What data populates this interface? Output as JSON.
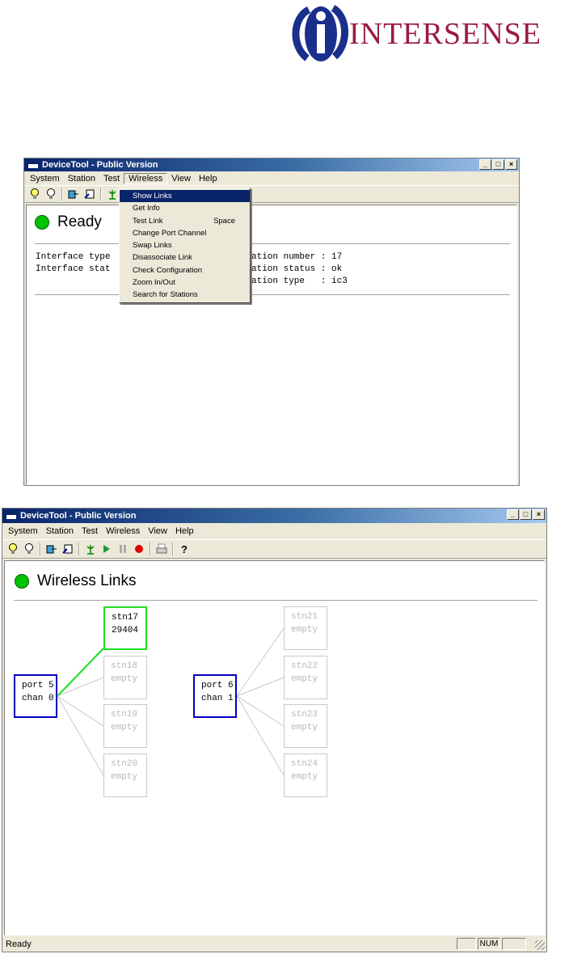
{
  "logo": {
    "wordmark": "INTERSENSE"
  },
  "window1": {
    "title": "DeviceTool - Public Version",
    "menu": [
      "System",
      "Station",
      "Test",
      "Wireless",
      "View",
      "Help"
    ],
    "status_label": "Ready",
    "info_left": [
      "Interface type",
      "Interface stat"
    ],
    "info_right": [
      "ation number : 17",
      "ation status : ok",
      "ation type   : ic3"
    ],
    "dropdown": [
      {
        "label": "Show Links",
        "accel": "",
        "highlighted": true
      },
      {
        "label": "Get Info",
        "accel": ""
      },
      {
        "label": "Test Link",
        "accel": "Space"
      },
      {
        "label": "Change Port Channel",
        "accel": ""
      },
      {
        "label": "Swap Links",
        "accel": ""
      },
      {
        "label": "Disassociate Link",
        "accel": ""
      },
      {
        "label": "Check Configuration",
        "accel": ""
      },
      {
        "label": "Zoom In/Out",
        "accel": ""
      },
      {
        "label": "Search for Stations",
        "accel": ""
      }
    ]
  },
  "window2": {
    "title": "DeviceTool - Public Version",
    "menu": [
      "System",
      "Station",
      "Test",
      "Wireless",
      "View",
      "Help"
    ],
    "header": "Wireless Links",
    "ports": [
      {
        "line1": "port 5",
        "line2": "chan 0",
        "stations": [
          {
            "line1": "stn17",
            "line2": "29404",
            "linked": true
          },
          {
            "line1": "stn18",
            "line2": "empty",
            "linked": false
          },
          {
            "line1": "stn19",
            "line2": "empty",
            "linked": false
          },
          {
            "line1": "stn20",
            "line2": "empty",
            "linked": false
          }
        ]
      },
      {
        "line1": "port 6",
        "line2": "chan 1",
        "stations": [
          {
            "line1": "stn21",
            "line2": "empty",
            "linked": false
          },
          {
            "line1": "stn22",
            "line2": "empty",
            "linked": false
          },
          {
            "line1": "stn23",
            "line2": "empty",
            "linked": false
          },
          {
            "line1": "stn24",
            "line2": "empty",
            "linked": false
          }
        ]
      }
    ],
    "statusbar": {
      "text": "Ready",
      "num": "NUM"
    },
    "colors": {
      "linked": "#22dd22",
      "port": "#0000c0",
      "empty": "#c8c8c8"
    }
  }
}
